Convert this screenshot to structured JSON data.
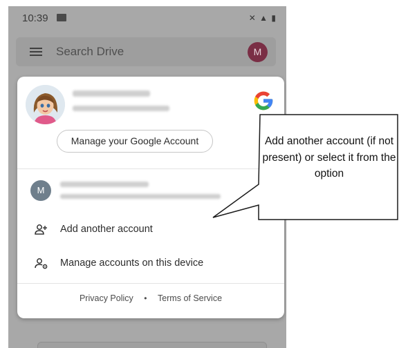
{
  "status_bar": {
    "time": "10:39",
    "gallery_icon": "image-icon",
    "icons": [
      "mute-icon",
      "signal-icon",
      "battery-icon"
    ]
  },
  "search_bar": {
    "menu_icon": "hamburger-menu-icon",
    "placeholder": "Search Drive",
    "avatar_letter": "M",
    "avatar_color": "#7a2e45"
  },
  "account_sheet": {
    "manage_account_label": "Manage your Google Account",
    "second_account_avatar_letter": "M",
    "add_account_label": "Add another account",
    "manage_device_accounts_label": "Manage accounts on this device",
    "footer": {
      "privacy_label": "Privacy Policy",
      "separator": "•",
      "terms_label": "Terms of Service"
    }
  },
  "callout": {
    "text": "Add another account (if not present) or select it from the option"
  },
  "colors": {
    "google_blue": "#4285F4",
    "google_red": "#EA4335",
    "google_yellow": "#FBBC05",
    "google_green": "#34A853"
  }
}
